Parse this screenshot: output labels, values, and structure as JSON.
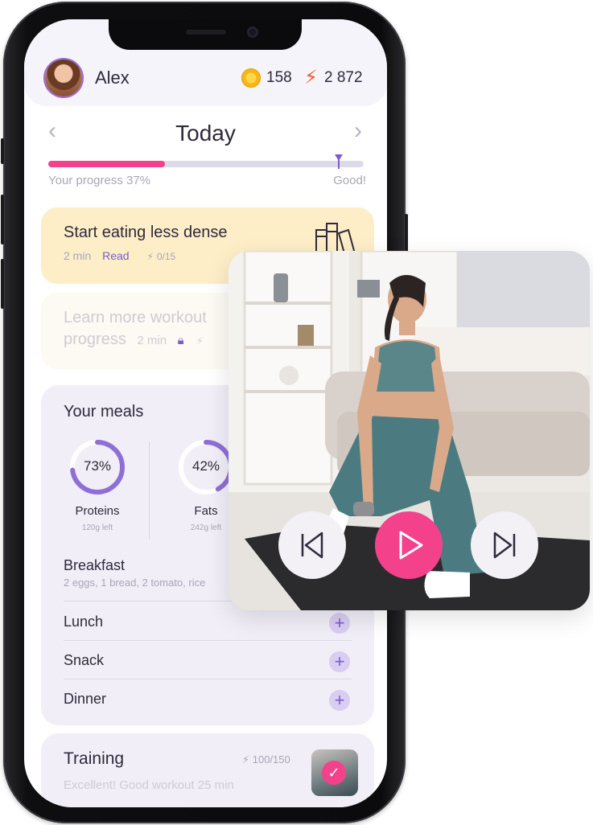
{
  "header": {
    "user_name": "Alex",
    "coins": "158",
    "energy": "2 872"
  },
  "day": {
    "title": "Today",
    "progress_label": "Your progress 37%",
    "progress_percent": 37,
    "goal_label": "Good!"
  },
  "tips": [
    {
      "title": "Start eating less dense",
      "duration": "2 min",
      "action": "Read",
      "points": "0/15"
    },
    {
      "title": "Learn more workout progress",
      "title_line1": "Learn more workout",
      "title_line2": "progress",
      "duration": "2 min"
    }
  ],
  "meals": {
    "title": "Your meals",
    "macros": [
      {
        "name": "Proteins",
        "percent": 73,
        "percent_label": "73%",
        "left": "120g left"
      },
      {
        "name": "Fats",
        "percent": 42,
        "percent_label": "42%",
        "left": "242g left"
      }
    ],
    "items": [
      {
        "name": "Breakfast",
        "desc": "2 eggs, 1 bread, 2 tomato, rice"
      },
      {
        "name": "Lunch"
      },
      {
        "name": "Snack"
      },
      {
        "name": "Dinner"
      }
    ],
    "add_symbol": "+"
  },
  "training": {
    "title": "Training",
    "points": "100/150",
    "subtitle": "Excellent! Good workout 25 min"
  },
  "colors": {
    "accent_pink": "#f3418c",
    "accent_purple": "#7b5cd0",
    "tip_yellow": "#fdeec8"
  },
  "icons": [
    "coin-icon",
    "bolt-icon",
    "books-icon",
    "lock-icon",
    "play-icon",
    "previous-icon",
    "next-icon",
    "check-icon"
  ]
}
